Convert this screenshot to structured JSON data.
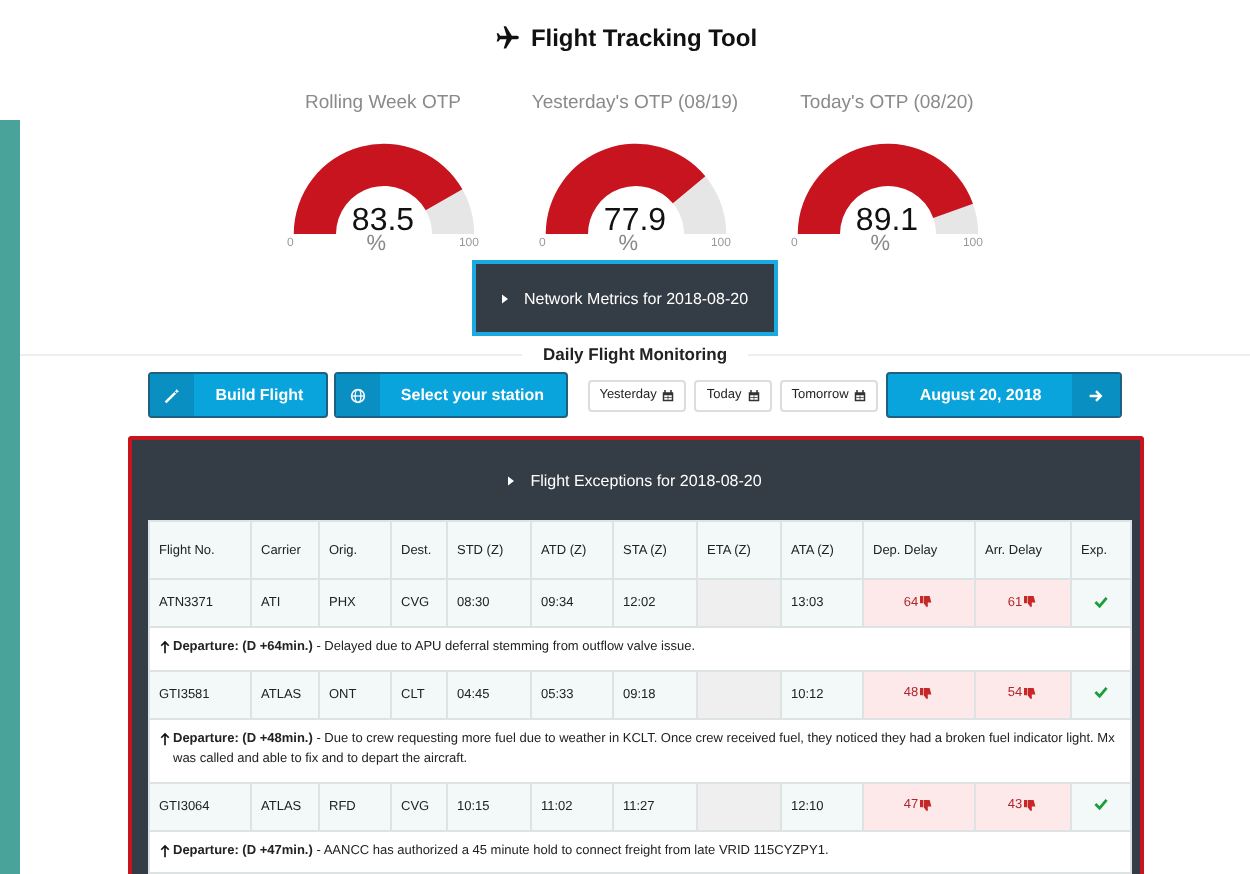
{
  "title": "Flight Tracking Tool",
  "gauges": [
    {
      "label": "Rolling Week OTP",
      "value": "83.5",
      "unit": "%",
      "min": "0",
      "max": "100",
      "level": 0.835
    },
    {
      "label": "Yesterday's OTP (08/19)",
      "value": "77.9",
      "unit": "%",
      "min": "0",
      "max": "100",
      "level": 0.779
    },
    {
      "label": "Today's OTP (08/20)",
      "value": "89.1",
      "unit": "%",
      "min": "0",
      "max": "100",
      "level": 0.891
    }
  ],
  "network_metrics": {
    "label": "Network Metrics for 2018-08-20"
  },
  "section_title": "Daily Flight Monitoring",
  "toolbar": {
    "build": "Build Flight",
    "station": "Select your station",
    "days": [
      "Yesterday",
      "Today",
      "Tomorrow"
    ],
    "date": "August 20, 2018"
  },
  "exceptions": {
    "title": "Flight Exceptions for 2018-08-20",
    "columns": [
      "Flight No.",
      "Carrier",
      "Orig.",
      "Dest.",
      "STD (Z)",
      "ATD (Z)",
      "STA (Z)",
      "ETA (Z)",
      "ATA (Z)",
      "Dep. Delay",
      "Arr. Delay",
      "Exp."
    ],
    "rows": [
      {
        "flight": "ATN3371",
        "carrier": "ATI",
        "orig": "PHX",
        "dest": "CVG",
        "std": "08:30",
        "atd": "09:34",
        "sta": "12:02",
        "ata": "13:03",
        "dep_delay": "64",
        "arr_delay": "61",
        "explained": true,
        "note": "**Departure: (D +64min.)** - Delayed due to APU deferral stemming from outflow valve issue."
      },
      {
        "flight": "GTI3581",
        "carrier": "ATLAS",
        "orig": "ONT",
        "dest": "CLT",
        "std": "04:45",
        "atd": "05:33",
        "sta": "09:18",
        "ata": "10:12",
        "dep_delay": "48",
        "arr_delay": "54",
        "explained": true,
        "note": "**Departure: (D +48min.)** - Due to crew requesting more fuel due to weather in KCLT. Once crew received fuel, they noticed they had a broken fuel indicator light. Mx was called and able to fix and to depart the aircraft."
      },
      {
        "flight": "GTI3064",
        "carrier": "ATLAS",
        "orig": "RFD",
        "dest": "CVG",
        "std": "10:15",
        "atd": "11:02",
        "sta": "11:27",
        "ata": "12:10",
        "dep_delay": "47",
        "arr_delay": "43",
        "explained": true,
        "note": "**Departure: (D +47min.)** - AANCC has authorized a 45 minute hold to connect freight from late VRID 115CYZPY1."
      }
    ]
  }
}
